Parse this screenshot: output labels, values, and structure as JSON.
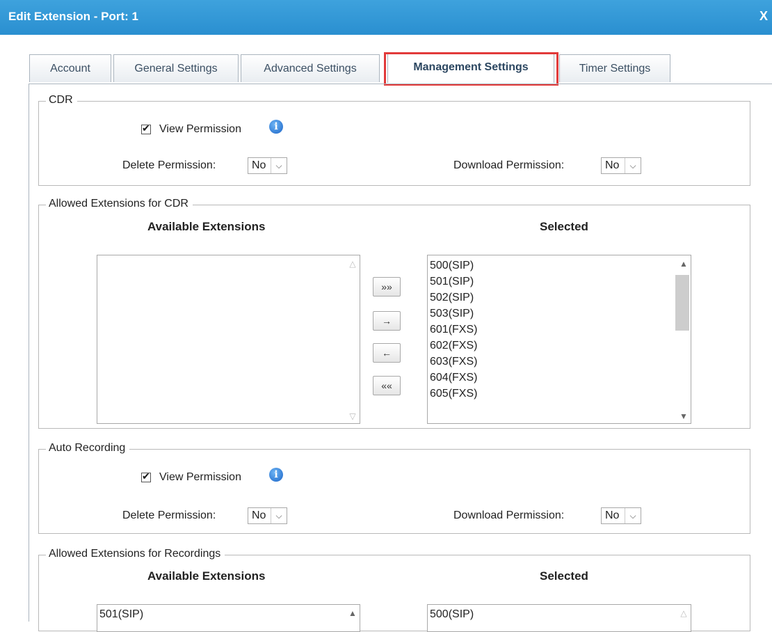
{
  "dialog": {
    "title": "Edit Extension - Port: 1",
    "close_label": "X"
  },
  "tabs": [
    {
      "label": "Account"
    },
    {
      "label": "General Settings"
    },
    {
      "label": "Advanced Settings"
    },
    {
      "label": "Management Settings"
    },
    {
      "label": "Timer Settings"
    }
  ],
  "cdr": {
    "legend": "CDR",
    "view_permission": "View Permission",
    "delete_permission_label": "Delete Permission:",
    "delete_permission_value": "No",
    "download_permission_label": "Download Permission:",
    "download_permission_value": "No"
  },
  "allowed_cdr": {
    "legend": "Allowed Extensions for CDR",
    "available_header": "Available Extensions",
    "selected_header": "Selected",
    "selected_items": [
      "500(SIP)",
      "501(SIP)",
      "502(SIP)",
      "503(SIP)",
      "601(FXS)",
      "602(FXS)",
      "603(FXS)",
      "604(FXS)",
      "605(FXS)"
    ]
  },
  "move_buttons": {
    "add_all": "»»",
    "add": "→",
    "remove": "←",
    "remove_all": "««"
  },
  "auto_recording": {
    "legend": "Auto Recording",
    "view_permission": "View Permission",
    "delete_permission_label": "Delete Permission:",
    "delete_permission_value": "No",
    "download_permission_label": "Download Permission:",
    "download_permission_value": "No"
  },
  "allowed_recordings": {
    "legend": "Allowed Extensions for Recordings",
    "available_header": "Available Extensions",
    "selected_header": "Selected",
    "available_items": [
      "501(SIP)"
    ],
    "selected_items": [
      "500(SIP)"
    ]
  },
  "icons": {
    "info": "info-icon",
    "checkbox": "checkmark",
    "dropdown": "chevron-down-icon"
  },
  "colors": {
    "titlebar": "#2a8fd0",
    "tab_highlight": "#e23a3a"
  }
}
